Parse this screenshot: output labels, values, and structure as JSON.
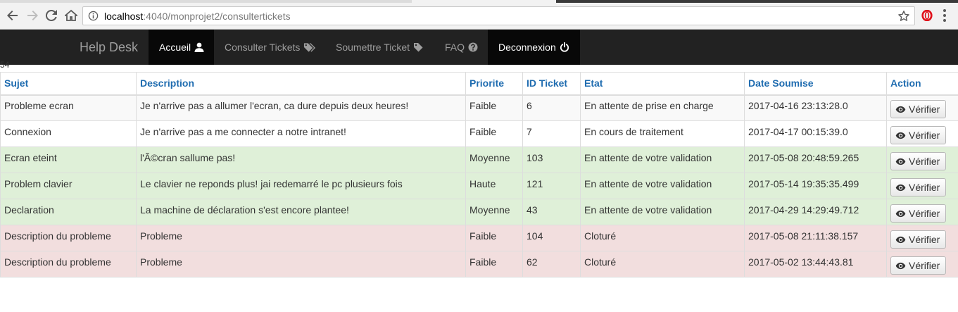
{
  "browser": {
    "url_host": "localhost",
    "url_path": ":4040/monprojet2/consultertickets"
  },
  "navbar": {
    "brand": "Help Desk",
    "items": [
      {
        "label": "Accueil",
        "icon": "user-icon",
        "state": "active"
      },
      {
        "label": "Consulter Tickets",
        "icon": "tags-icon",
        "state": "normal"
      },
      {
        "label": "Soumettre Ticket",
        "icon": "tag-icon",
        "state": "normal"
      },
      {
        "label": "FAQ",
        "icon": "question-circle-icon",
        "state": "normal"
      },
      {
        "label": "Deconnexion",
        "icon": "power-icon",
        "state": "dark"
      }
    ]
  },
  "stray_text": "54",
  "table": {
    "headers": [
      "Sujet",
      "Description",
      "Priorite",
      "ID Ticket",
      "Etat",
      "Date Soumise",
      "Action"
    ],
    "rows": [
      {
        "sujet": "Probleme ecran",
        "description": "Je n'arrive pas a allumer l'ecran, ca dure depuis deux heures!",
        "priorite": "Faible",
        "id": "6",
        "etat": "En attente de prise en charge",
        "date": "2017-04-16 23:13:28.0",
        "action": "Vérifier",
        "status": "default"
      },
      {
        "sujet": "Connexion",
        "description": "Je n'arrive pas a me connecter a notre intranet!",
        "priorite": "Faible",
        "id": "7",
        "etat": "En cours de traitement",
        "date": "2017-04-17 00:15:39.0",
        "action": "Vérifier",
        "status": "default"
      },
      {
        "sujet": "Ecran eteint",
        "description": "l'Ã©cran sallume pas!",
        "priorite": "Moyenne",
        "id": "103",
        "etat": "En attente de votre validation",
        "date": "2017-05-08 20:48:59.265",
        "action": "Vérifier",
        "status": "success"
      },
      {
        "sujet": "Problem clavier",
        "description": "Le clavier ne reponds plus! jai redemarré le pc plusieurs fois",
        "priorite": "Haute",
        "id": "121",
        "etat": "En attente de votre validation",
        "date": "2017-05-14 19:35:35.499",
        "action": "Vérifier",
        "status": "success"
      },
      {
        "sujet": "Declaration",
        "description": "La machine de déclaration s'est encore plantee!",
        "priorite": "Moyenne",
        "id": "43",
        "etat": "En attente de votre validation",
        "date": "2017-04-29 14:29:49.712",
        "action": "Vérifier",
        "status": "success"
      },
      {
        "sujet": "Description du probleme",
        "description": "Probleme",
        "priorite": "Faible",
        "id": "104",
        "etat": "Cloturé",
        "date": "2017-05-08 21:11:38.157",
        "action": "Vérifier",
        "status": "danger"
      },
      {
        "sujet": "Description du probleme",
        "description": "Probleme",
        "priorite": "Faible",
        "id": "62",
        "etat": "Cloturé",
        "date": "2017-05-02 13:44:43.81",
        "action": "Vérifier",
        "status": "danger"
      }
    ]
  },
  "colors": {
    "navbar_bg": "#222222",
    "header_text": "#1f6cb0",
    "row_success": "#dff0d8",
    "row_danger": "#f2dede"
  }
}
